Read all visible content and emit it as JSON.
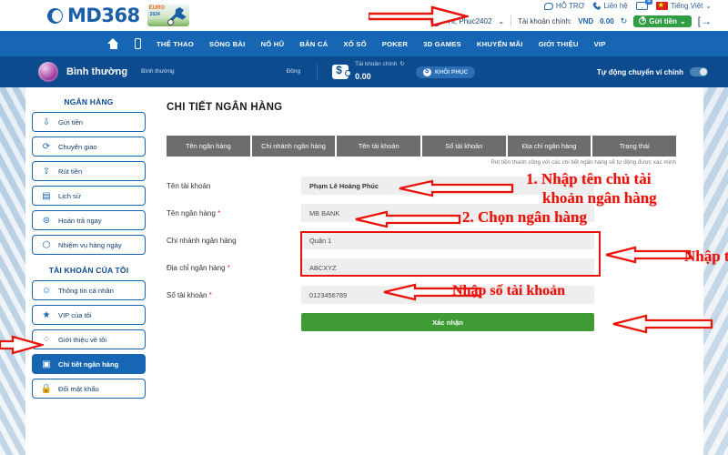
{
  "brand": {
    "logo_text": "MD368",
    "logo_c": "C",
    "euro_top": "EURO",
    "euro_year": "2024"
  },
  "header": {
    "links": [
      {
        "label": "HỖ TRỢ",
        "icon": "chat-icon"
      },
      {
        "label": "Liên hệ",
        "icon": "phone-icon"
      },
      {
        "label": "",
        "icon": "mail-icon",
        "badge": "3"
      },
      {
        "label": "Tiếng Việt",
        "icon": "flag-icon",
        "caret": "⌄"
      }
    ],
    "account": {
      "greeting": "Hi, Phuc2402",
      "caret": "⌄",
      "balance_label": "Tài khoản chính:",
      "currency": "VND",
      "balance": "0.00",
      "refresh_icon": "↻",
      "deposit_label": "Gửi tiền",
      "deposit_caret": "⌄",
      "logout_icon": "[→"
    }
  },
  "nav": {
    "home_icon": "home-icon",
    "mobile_icon": "mobile-icon",
    "items": [
      "THỂ THAO",
      "SÒNG BÀI",
      "NỔ HŨ",
      "BẮN CÁ",
      "XỔ SỐ",
      "POKER",
      "3D GAMES",
      "KHUYẾN MÃI",
      "GIỚI THIỆU",
      "VIP"
    ]
  },
  "userstrip": {
    "vip_level": "Bình thường",
    "progress_label": "Bình thường",
    "progress_right": "Đồng",
    "wallet_label": "Tài khoản chính",
    "wallet_refresh": "↻",
    "wallet_value": "0.00",
    "restore_label": "KHÔI PHỤC",
    "auto_transfer_label": "Tự động chuyển ví chính"
  },
  "sidebar": {
    "section1_title": "NGÂN HÀNG",
    "section1_items": [
      {
        "label": "Gửi tiền",
        "icon": "deposit-icon",
        "glyph": "⇩"
      },
      {
        "label": "Chuyển giao",
        "icon": "transfer-icon",
        "glyph": "⟳"
      },
      {
        "label": "Rút tiền",
        "icon": "withdraw-icon",
        "glyph": "⇪"
      },
      {
        "label": "Lịch sử",
        "icon": "history-icon",
        "glyph": "▤"
      },
      {
        "label": "Hoàn trả ngay",
        "icon": "rebate-icon",
        "glyph": "⊜"
      },
      {
        "label": "Nhiệm vụ hàng ngày",
        "icon": "mission-icon",
        "glyph": "⬡"
      }
    ],
    "section2_title": "TÀI KHOẢN CỦA TÔI",
    "section2_items": [
      {
        "label": "Thông tin cá nhân",
        "icon": "profile-icon",
        "glyph": "☺",
        "active": false
      },
      {
        "label": "VIP của tôi",
        "icon": "vip-icon",
        "glyph": "★",
        "active": false
      },
      {
        "label": "Giới thiệu về tôi",
        "icon": "referral-icon",
        "glyph": "⁘",
        "active": false
      },
      {
        "label": "Chi tiết ngân hàng",
        "icon": "bank-details-icon",
        "glyph": "▣",
        "active": true
      },
      {
        "label": "Đổi mật khẩu",
        "icon": "password-icon",
        "glyph": "🔒",
        "active": false
      }
    ]
  },
  "main": {
    "title": "CHI TIẾT NGÂN HÀNG",
    "tabs": [
      "Tên ngân hàng",
      "Chi nhánh ngân hàng",
      "Tên tài khoản",
      "Số tài khoản",
      "Địa chỉ ngân hàng",
      "Trạng thái"
    ],
    "tab_note": "Rút tiền thanh công với các chi tiết ngân hàng sẽ tự động được xác minh",
    "fields": [
      {
        "label": "Tên tài khoản",
        "required": false,
        "value": "Phạm Lê Hoàng Phúc",
        "placeholder": ""
      },
      {
        "label": "Tên ngân hàng",
        "required": true,
        "value": "MB BANK",
        "placeholder": ""
      },
      {
        "label": "Chi nhánh ngân hàng",
        "required": false,
        "value": "Quận 1",
        "placeholder": ""
      },
      {
        "label": "Địa chỉ ngân hàng",
        "required": true,
        "value": "ABCXYZ",
        "placeholder": ""
      },
      {
        "label": "Số tài khoản",
        "required": true,
        "value": "0123456789",
        "placeholder": ""
      }
    ],
    "required_mark": "*",
    "confirm_label": "Xác nhận"
  },
  "annotations": {
    "note1_line1": "1. Nhập tên chủ tài",
    "note1_line2": "khoản ngân hàng",
    "note2": "2. Chọn ngân hàng",
    "note3": "Nhập t",
    "note4": "Nhập số tài khoản"
  },
  "colors": {
    "brand_blue": "#1766b3",
    "strip_blue": "#0d4b8f",
    "confirm_green": "#3f9c35",
    "annotation_red": "#e8140c",
    "tab_gray": "#6d6d6d"
  }
}
